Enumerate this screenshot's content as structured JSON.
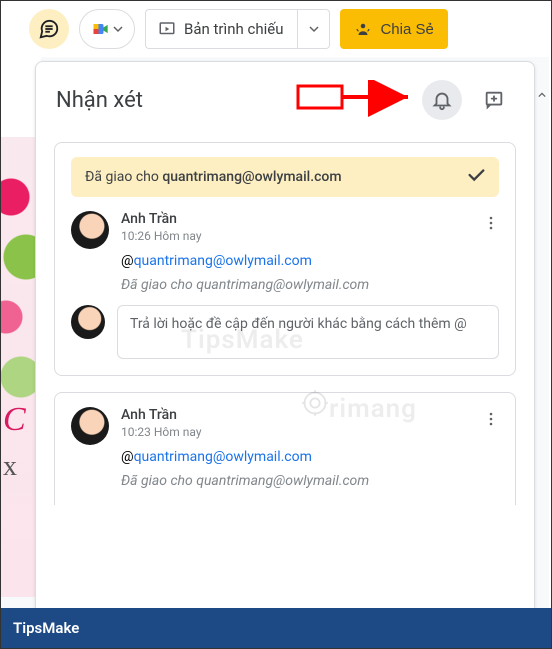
{
  "toolbar": {
    "present_label": "Bản trình chiếu",
    "share_label": "Chia Sẻ"
  },
  "panel": {
    "title": "Nhận xét"
  },
  "card1": {
    "assigned_prefix": "Đã giao cho ",
    "assigned_email": "quantrimang@owlymail.com",
    "author": "Anh Trần",
    "timestamp": "10:26 Hôm nay",
    "mention_prefix": "@",
    "mention_email": "quantrimang@owlymail.com",
    "assigned_line": "Đã giao cho quantrimang@owlymail.com",
    "reply_placeholder": "Trả lời hoặc đề cập đến người khác bằng cách thêm @"
  },
  "card2": {
    "author": "Anh Trần",
    "timestamp": "10:23 Hôm nay",
    "mention_prefix": "@",
    "mention_email": "quantrimang@owlymail.com",
    "assigned_line": "Đã giao cho quantrimang@owlymail.com"
  },
  "watermarks": {
    "w1": "TipsMake",
    "w2": "rimang"
  },
  "footer": {
    "label": "TipsMake"
  },
  "bg": {
    "c": "C",
    "x": "x"
  }
}
